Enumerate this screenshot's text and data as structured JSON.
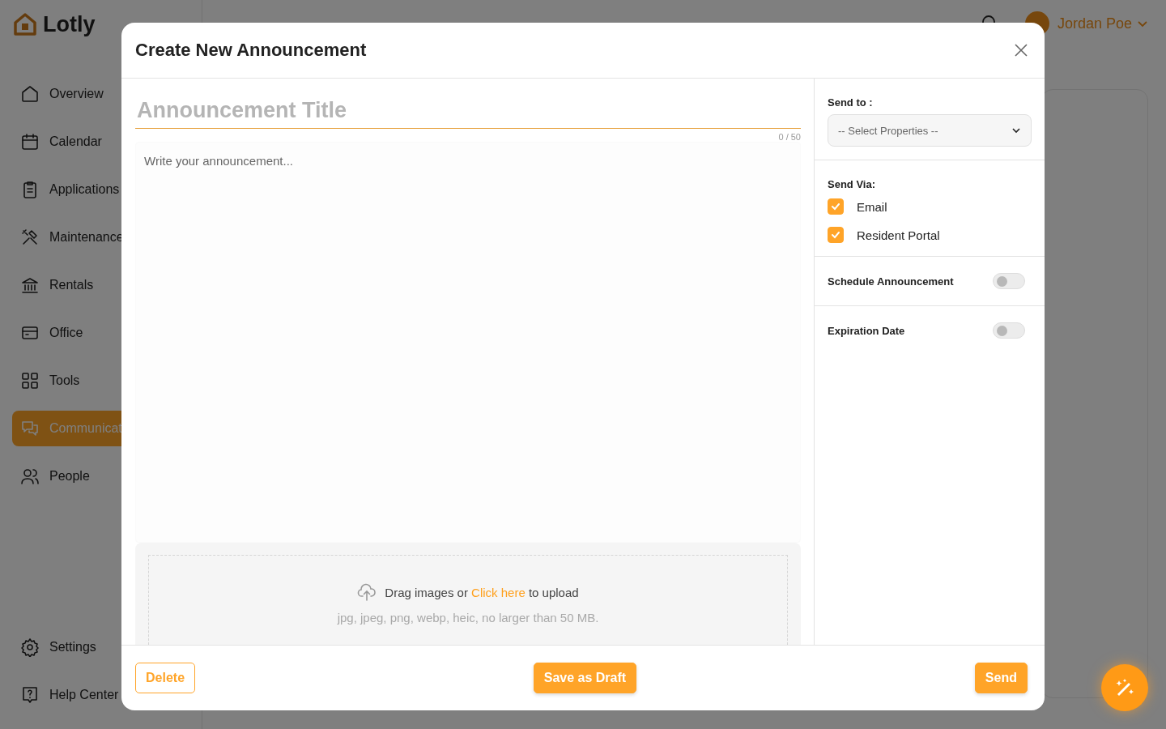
{
  "app": {
    "logo": "Lotly"
  },
  "sidebar": {
    "items": [
      {
        "label": "Overview",
        "selected": false
      },
      {
        "label": "Calendar",
        "selected": false
      },
      {
        "label": "Applications",
        "selected": false
      },
      {
        "label": "Maintenance",
        "selected": false
      },
      {
        "label": "Rentals",
        "selected": false
      },
      {
        "label": "Office",
        "selected": false
      },
      {
        "label": "Tools",
        "selected": false
      },
      {
        "label": "Communicat",
        "selected": true
      },
      {
        "label": "People",
        "selected": false
      }
    ],
    "bottom_items": [
      {
        "label": "Settings",
        "selected": false
      },
      {
        "label": "Help Center",
        "selected": false
      }
    ]
  },
  "header": {
    "user": "Jordan Poe"
  },
  "modal": {
    "title": "Create New Announcement",
    "title_field": {
      "placeholder": "Announcement Title",
      "counter": "0 / 50"
    },
    "body_field": {
      "placeholder": "Write your announcement..."
    },
    "upload": {
      "text": "Drag images or **Click here** to upload",
      "hint": "jpg, jpeg, png, webp, heic, no larger than 50 MB."
    },
    "send_to": {
      "label": "Send to :",
      "placeholder": "-- Select Properties --"
    },
    "send_via": {
      "label": "Send Via:",
      "options": [
        {
          "label": "Email",
          "checked": true
        },
        {
          "label": "Resident Portal",
          "checked": true
        }
      ]
    },
    "toggles": [
      {
        "label": "Schedule Announcement",
        "on": false
      },
      {
        "label": "Expiration Date",
        "on": false
      }
    ],
    "buttons": [
      {
        "label": "Delete",
        "kind": "outline"
      },
      {
        "label": "Save as Draft",
        "kind": "filled"
      },
      {
        "label": "Send",
        "kind": "filled"
      }
    ]
  }
}
